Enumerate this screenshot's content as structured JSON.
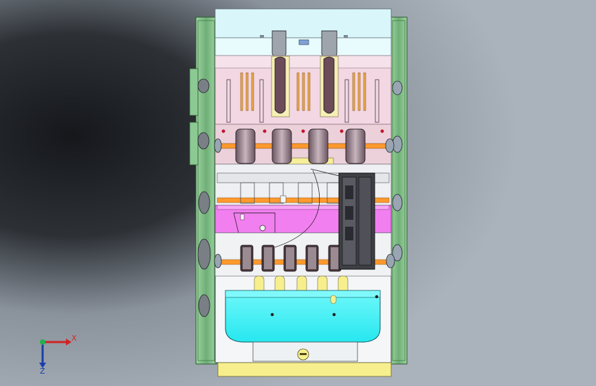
{
  "viewport": {
    "background_left": "#1e2126",
    "background_right": "#a9b1bb"
  },
  "model": {
    "frame_color": "#7fbf86",
    "body_color": "#f4f6f8",
    "top_band_color": "#d9f7fb",
    "pink_color": "#f0c7d9",
    "magenta_color": "#f27ff0",
    "cyan_color": "#36f2f6",
    "yellow_color": "#f7ef8e",
    "orange_color": "#ff9a2e",
    "dark_block_color": "#3f4046"
  },
  "triad": {
    "x_label": "X",
    "z_label": "Z",
    "x_color": "#d22222",
    "y_color": "#22b24a",
    "z_color": "#1a3fa8"
  }
}
